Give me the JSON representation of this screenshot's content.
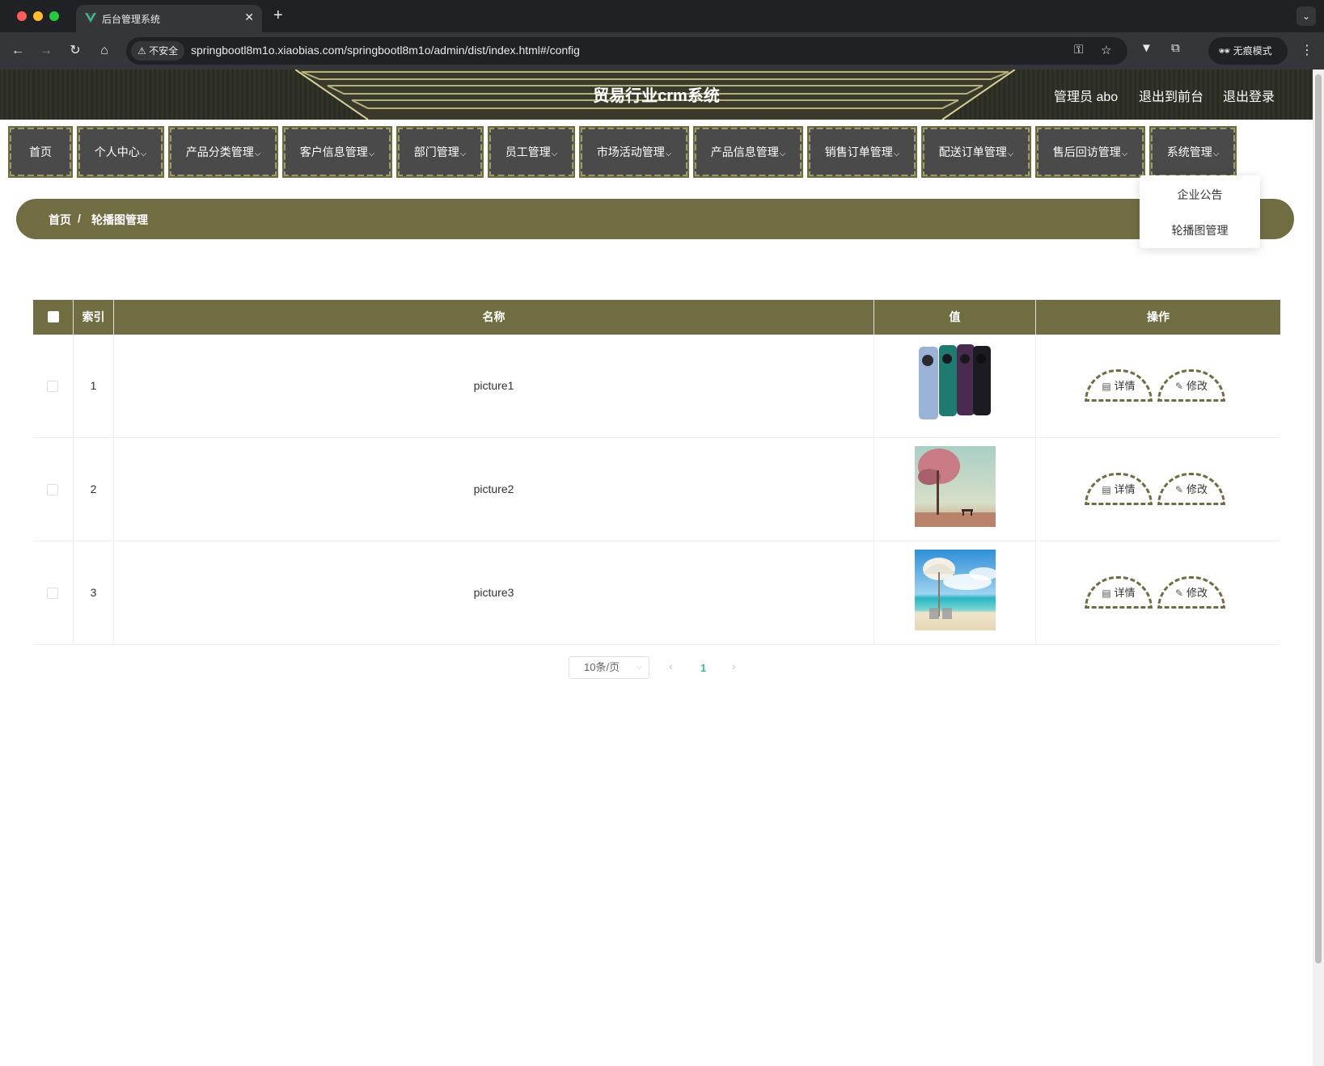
{
  "browser": {
    "tab_title": "后台管理系统",
    "new_tab": "+",
    "security_label": "不安全",
    "url": "springbootl8m1o.xiaobias.com/springbootl8m1o/admin/dist/index.html#/config",
    "incognito_label": "无痕模式"
  },
  "header": {
    "title": "贸易行业crm系统",
    "user": "管理员 abo",
    "to_front": "退出到前台",
    "logout": "退出登录"
  },
  "menu": {
    "items": [
      {
        "label": "首页",
        "chevron": ""
      },
      {
        "label": "个人中心",
        "chevron": "⌵"
      },
      {
        "label": "产品分类管理",
        "chevron": "⌵"
      },
      {
        "label": "客户信息管理",
        "chevron": "⌵"
      },
      {
        "label": "部门管理",
        "chevron": "⌵"
      },
      {
        "label": "员工管理",
        "chevron": "⌵"
      },
      {
        "label": "市场活动管理",
        "chevron": "⌵"
      },
      {
        "label": "产品信息管理",
        "chevron": "⌵"
      },
      {
        "label": "销售订单管理",
        "chevron": "⌵"
      },
      {
        "label": "配送订单管理",
        "chevron": "⌵"
      },
      {
        "label": "售后回访管理",
        "chevron": "⌵"
      },
      {
        "label": "系统管理",
        "chevron": "⌵"
      }
    ],
    "dropdown": [
      "企业公告",
      "轮播图管理"
    ]
  },
  "breadcrumb": {
    "home": "首页",
    "separator": "/",
    "current": "轮播图管理"
  },
  "table": {
    "columns": [
      "索引",
      "名称",
      "值",
      "操作"
    ],
    "rows": [
      {
        "index": "1",
        "name": "picture1",
        "image": "phones-image"
      },
      {
        "index": "2",
        "name": "picture2",
        "image": "tree-bench-image"
      },
      {
        "index": "3",
        "name": "picture3",
        "image": "beach-umbrella-image"
      }
    ],
    "detail_label": "详情",
    "edit_label": "修改"
  },
  "pagination": {
    "page_size": "10条/页",
    "current_page": "1"
  },
  "colors": {
    "accent": "#716d43",
    "header_bg": "#2b2d24",
    "menu_bg": "#4a4a4a",
    "page_active": "#2fc497"
  }
}
